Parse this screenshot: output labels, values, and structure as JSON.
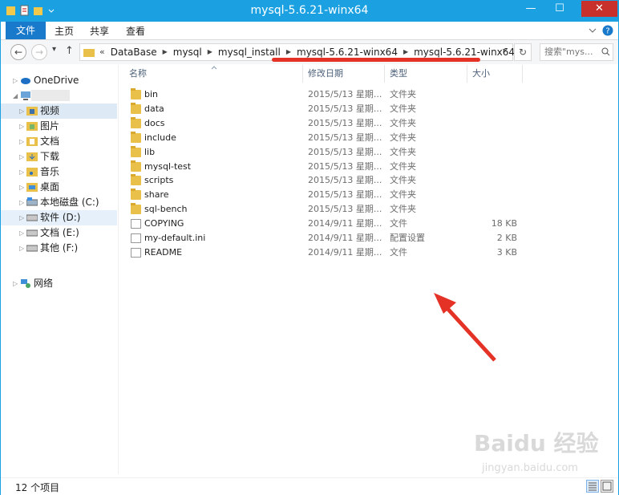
{
  "window": {
    "title": "mysql-5.6.21-winx64"
  },
  "titlebar": {
    "minimize": "—",
    "maximize": "☐",
    "close": "✕"
  },
  "ribbon": {
    "tabs": [
      "文件",
      "主页",
      "共享",
      "查看"
    ]
  },
  "nav_buttons": {
    "back": "←",
    "forward": "→",
    "recent": "▾",
    "up": "↑"
  },
  "address": {
    "overflow": "«",
    "crumbs": [
      "DataBase",
      "mysql",
      "mysql_install",
      "mysql-5.6.21-winx64",
      "mysql-5.6.21-winx64"
    ],
    "dropdown": "⌄",
    "refresh": "↻"
  },
  "search": {
    "placeholder": "搜索\"mys..."
  },
  "sidebar": {
    "items": [
      {
        "label": "OneDrive",
        "icon": "cloud-icon"
      },
      {
        "label": "",
        "icon": "computer-icon"
      },
      {
        "label": "视频",
        "icon": "videos-folder-icon",
        "selected": true
      },
      {
        "label": "图片",
        "icon": "pictures-folder-icon"
      },
      {
        "label": "文档",
        "icon": "documents-folder-icon"
      },
      {
        "label": "下载",
        "icon": "downloads-folder-icon"
      },
      {
        "label": "音乐",
        "icon": "music-folder-icon"
      },
      {
        "label": "桌面",
        "icon": "desktop-folder-icon"
      },
      {
        "label": "本地磁盘 (C:)",
        "icon": "drive-icon"
      },
      {
        "label": "软件 (D:)",
        "icon": "drive-icon"
      },
      {
        "label": "文档 (E:)",
        "icon": "drive-icon"
      },
      {
        "label": "其他 (F:)",
        "icon": "drive-icon"
      },
      {
        "label": "网络",
        "icon": "network-icon"
      }
    ]
  },
  "columns": {
    "name": "名称",
    "date": "修改日期",
    "type": "类型",
    "size": "大小"
  },
  "files": [
    {
      "name": "bin",
      "date": "2015/5/13 星期...",
      "type": "文件夹",
      "size": "",
      "kind": "folder"
    },
    {
      "name": "data",
      "date": "2015/5/13 星期...",
      "type": "文件夹",
      "size": "",
      "kind": "folder"
    },
    {
      "name": "docs",
      "date": "2015/5/13 星期...",
      "type": "文件夹",
      "size": "",
      "kind": "folder"
    },
    {
      "name": "include",
      "date": "2015/5/13 星期...",
      "type": "文件夹",
      "size": "",
      "kind": "folder"
    },
    {
      "name": "lib",
      "date": "2015/5/13 星期...",
      "type": "文件夹",
      "size": "",
      "kind": "folder"
    },
    {
      "name": "mysql-test",
      "date": "2015/5/13 星期...",
      "type": "文件夹",
      "size": "",
      "kind": "folder"
    },
    {
      "name": "scripts",
      "date": "2015/5/13 星期...",
      "type": "文件夹",
      "size": "",
      "kind": "folder"
    },
    {
      "name": "share",
      "date": "2015/5/13 星期...",
      "type": "文件夹",
      "size": "",
      "kind": "folder"
    },
    {
      "name": "sql-bench",
      "date": "2015/5/13 星期...",
      "type": "文件夹",
      "size": "",
      "kind": "folder"
    },
    {
      "name": "COPYING",
      "date": "2014/9/11 星期...",
      "type": "文件",
      "size": "18 KB",
      "kind": "file"
    },
    {
      "name": "my-default.ini",
      "date": "2014/9/11 星期...",
      "type": "配置设置",
      "size": "2 KB",
      "kind": "ini"
    },
    {
      "name": "README",
      "date": "2014/9/11 星期...",
      "type": "文件",
      "size": "3 KB",
      "kind": "file"
    }
  ],
  "status": {
    "count": "12 个项目"
  },
  "watermark": {
    "brand": "Baidu 经验",
    "url": "jingyan.baidu.com"
  },
  "colors": {
    "titlebar": "#1ba1e2",
    "file_tab": "#1979ca",
    "annotation": "#e53226"
  }
}
